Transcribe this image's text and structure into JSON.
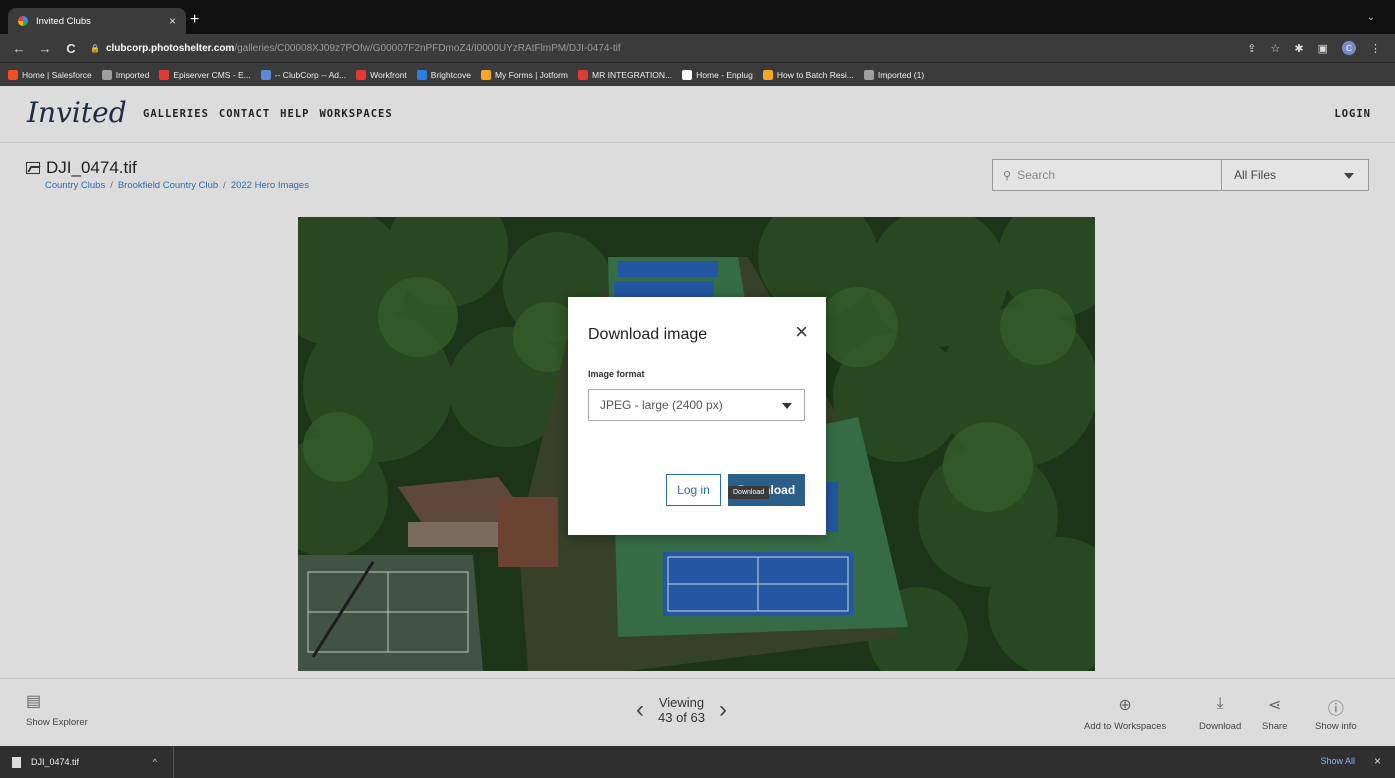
{
  "browser": {
    "tab_title": "Invited Clubs",
    "tab_close": "×",
    "new_tab": "+",
    "tab_menu": "⌄",
    "url_host": "clubcorp.photoshelter.com",
    "url_path": "/galleries/C00008XJ09z7POfw/G00007F2nPFDmoZ4/I0000UYzRAtFlmPM/DJI-0474-tif",
    "profile_initial": "C",
    "bookmarks": [
      {
        "label": "Home | Salesforce",
        "color": "#f25022"
      },
      {
        "label": "Imported",
        "color": "#9e9e9e"
      },
      {
        "label": "Episerver CMS - E...",
        "color": "#e53935"
      },
      {
        "label": "-- ClubCorp -- Ad...",
        "color": "#5b8bd6"
      },
      {
        "label": "Workfront",
        "color": "#e53935"
      },
      {
        "label": "Brightcove",
        "color": "#2a7de1"
      },
      {
        "label": "My Forms | Jotform",
        "color": "#f5a623"
      },
      {
        "label": "MR INTEGRATION...",
        "color": "#e53935"
      },
      {
        "label": "Home - Enplug",
        "color": "#ffffff"
      },
      {
        "label": "How to Batch Resi...",
        "color": "#f5a623"
      },
      {
        "label": "Imported (1)",
        "color": "#9e9e9e"
      }
    ]
  },
  "site": {
    "logo": "Invited",
    "nav": [
      "GALLERIES",
      "CONTACT",
      "HELP",
      "WORKSPACES"
    ],
    "login": "LOGIN"
  },
  "file": {
    "name": "DJI_0474.tif",
    "breadcrumb": [
      "Country Clubs",
      "Brookfield Country Club",
      "2022 Hero Images"
    ],
    "breadcrumb_sep": "/"
  },
  "search": {
    "placeholder": "Search",
    "filter_value": "All Files"
  },
  "modal": {
    "title": "Download image",
    "close": "×",
    "format_label": "Image format",
    "format_value": "JPEG - large (2400 px)",
    "login_button": "Log in",
    "download_button": "Download",
    "tooltip": "Download"
  },
  "bottom": {
    "show_explorer": "Show Explorer",
    "viewing_label": "Viewing",
    "viewing_count": "43 of 63",
    "add_to_workspaces": "Add to Workspaces",
    "download": "Download",
    "share": "Share",
    "show_info": "Show info"
  },
  "shelf": {
    "file": "DJI_0474.tif",
    "show_all": "Show All",
    "close": "×"
  }
}
